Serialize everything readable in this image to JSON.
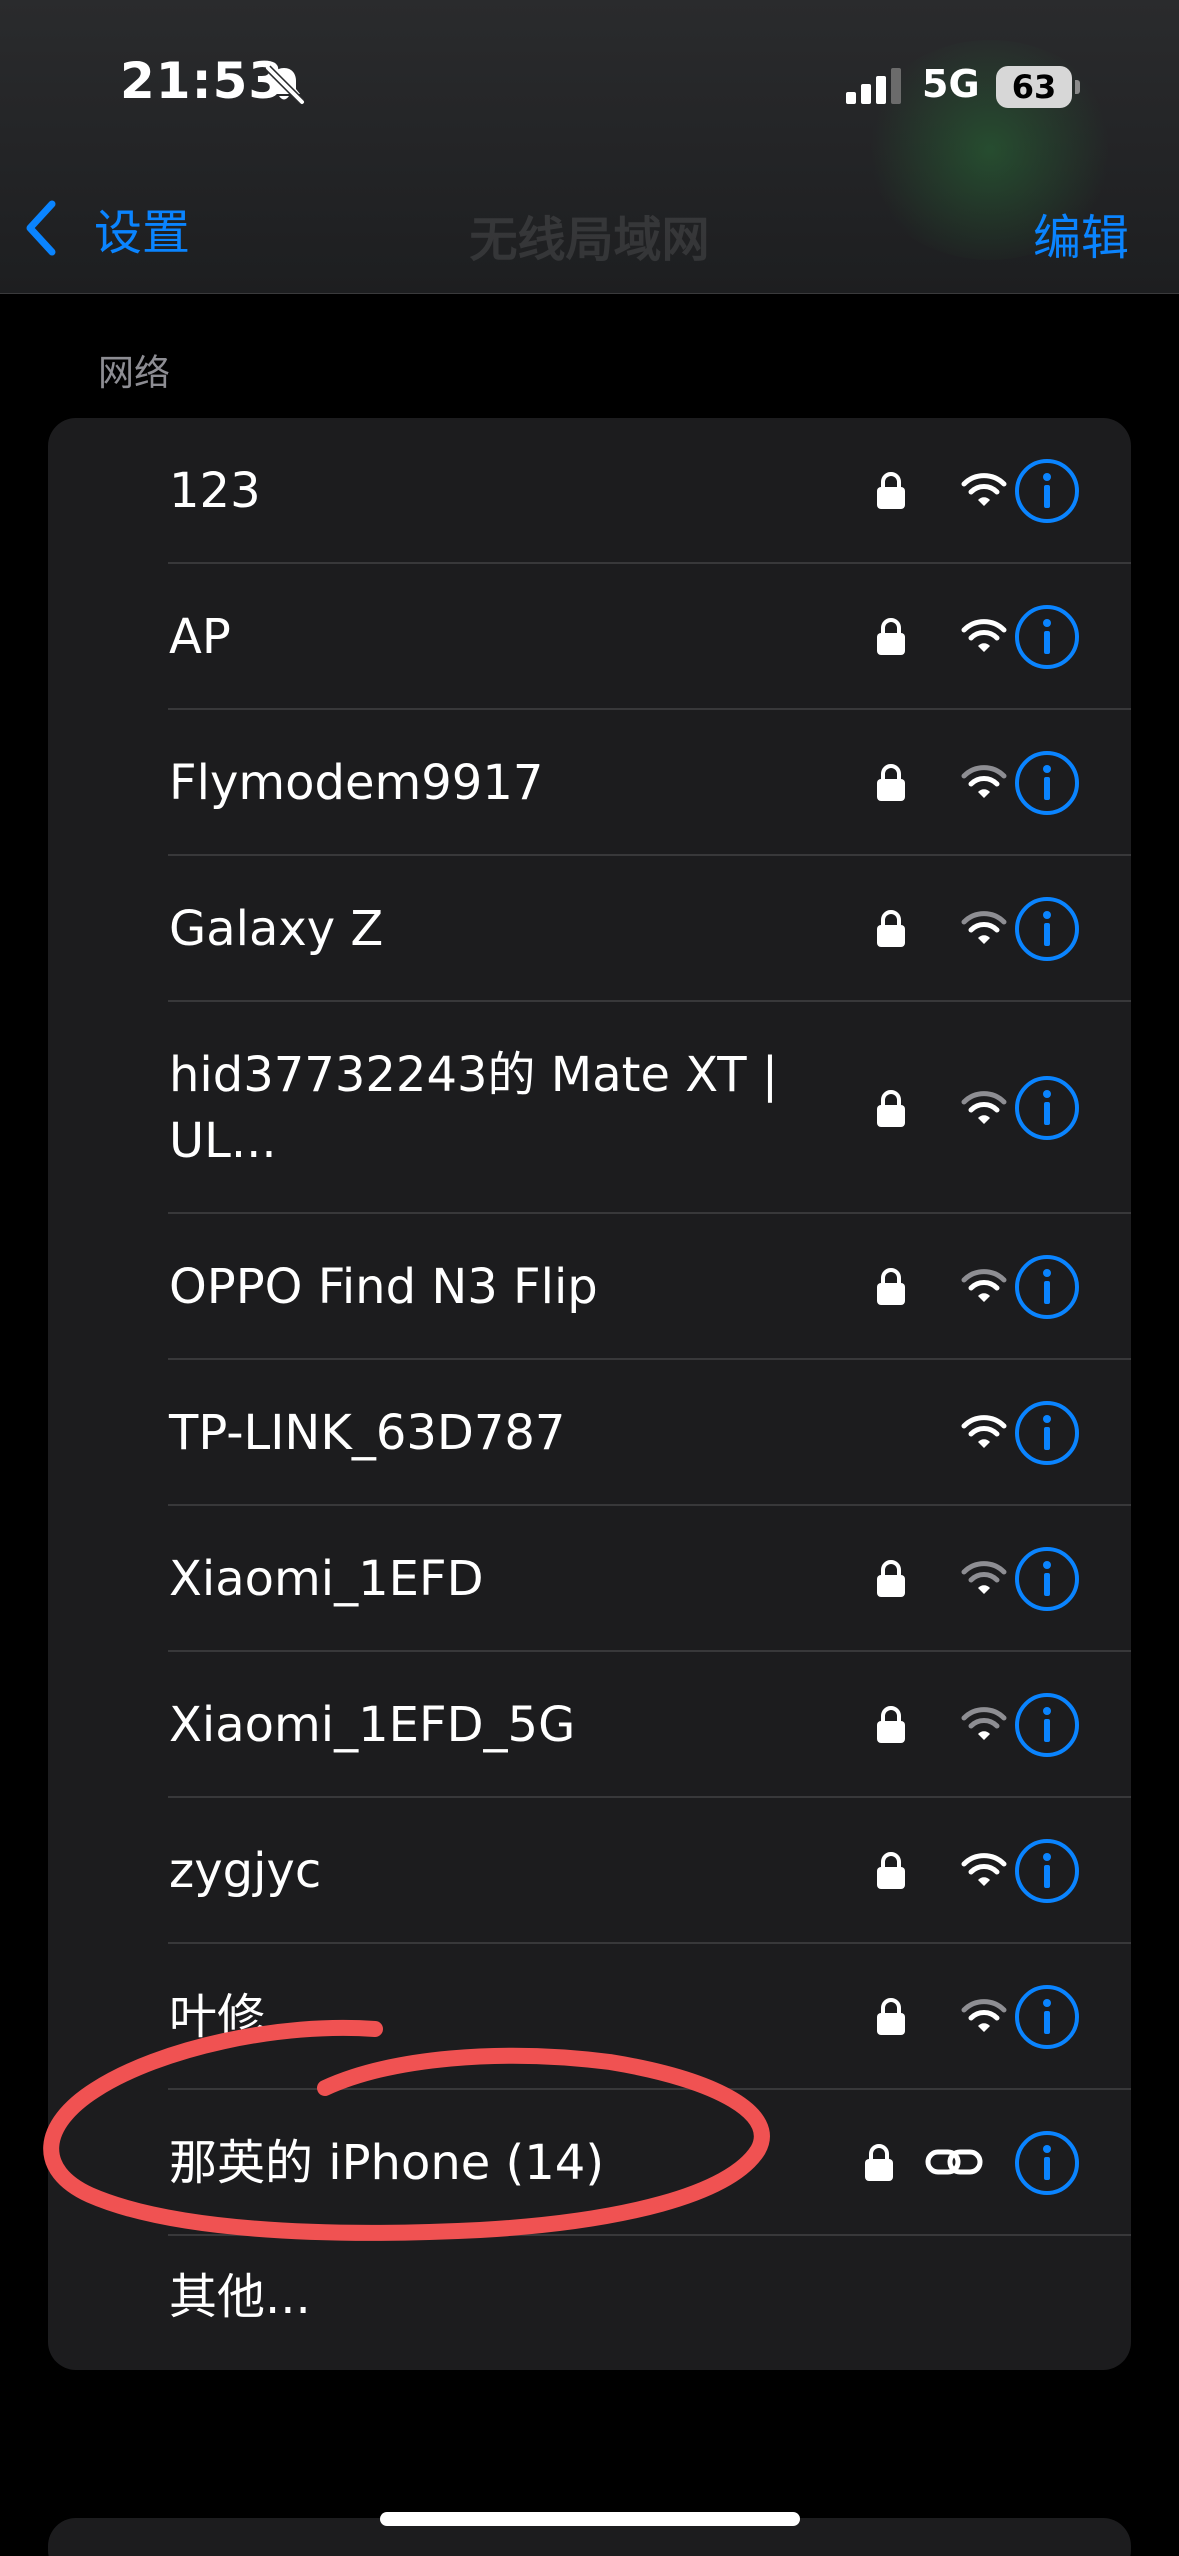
{
  "status_bar": {
    "time": "21:53",
    "network_type": "5G",
    "battery": "63",
    "icons": [
      "bell-slash-icon",
      "cellular-signal-icon"
    ]
  },
  "nav": {
    "back_label": "设置",
    "title": "无线局域网",
    "edit_label": "编辑"
  },
  "section_header": "网络",
  "networks": [
    {
      "name": "123",
      "secured": true,
      "icon": "wifi"
    },
    {
      "name": "AP",
      "secured": true,
      "icon": "wifi"
    },
    {
      "name": "Flymodem9917",
      "secured": true,
      "icon": "wifi"
    },
    {
      "name": "Galaxy Z",
      "secured": true,
      "icon": "wifi"
    },
    {
      "name": "hid37732243的 Mate XT |",
      "name_line2": "UL...",
      "secured": true,
      "icon": "wifi"
    },
    {
      "name": "OPPO Find N3 Flip",
      "secured": true,
      "icon": "wifi"
    },
    {
      "name": "TP-LINK_63D787",
      "secured": false,
      "icon": "wifi"
    },
    {
      "name": "Xiaomi_1EFD",
      "secured": true,
      "icon": "wifi"
    },
    {
      "name": "Xiaomi_1EFD_5G",
      "secured": true,
      "icon": "wifi"
    },
    {
      "name": "zygjyc",
      "secured": true,
      "icon": "wifi"
    },
    {
      "name": "叶修",
      "secured": true,
      "icon": "wifi"
    },
    {
      "name": "那英的 iPhone (14)",
      "secured": true,
      "icon": "personal-hotspot",
      "annotated": true
    }
  ],
  "other_label": "其他...",
  "colors": {
    "accent": "#0a84ff",
    "annotation": "#f05252",
    "card": "#1c1c1e",
    "background": "#000000"
  }
}
